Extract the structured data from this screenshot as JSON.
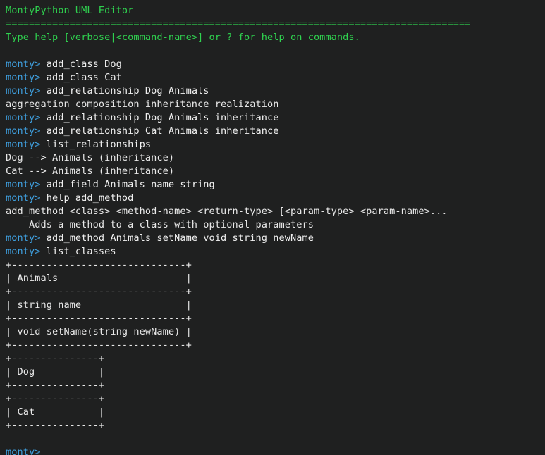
{
  "app": {
    "title": "MontyPython UML Editor",
    "separator": "================================================================================",
    "help_hint": "Type help [verbose|<command-name>] or ? for help on commands.",
    "prompt": "monty>",
    "colors": {
      "background": "#1f2020",
      "banner_green": "#2fd14f",
      "prompt_blue": "#3fa0e0",
      "output_white": "#e8e8e8"
    }
  },
  "session": {
    "lines": [
      {
        "kind": "banner",
        "text": "MontyPython UML Editor"
      },
      {
        "kind": "banner",
        "text": "================================================================================"
      },
      {
        "kind": "banner",
        "text": "Type help [verbose|<command-name>] or ? for help on commands."
      },
      {
        "kind": "blank",
        "text": ""
      },
      {
        "kind": "command",
        "prompt": "monty>",
        "text": " add_class Dog"
      },
      {
        "kind": "command",
        "prompt": "monty>",
        "text": " add_class Cat"
      },
      {
        "kind": "command",
        "prompt": "monty>",
        "text": " add_relationship Dog Animals"
      },
      {
        "kind": "output",
        "text": "aggregation composition inheritance realization"
      },
      {
        "kind": "command",
        "prompt": "monty>",
        "text": " add_relationship Dog Animals inheritance"
      },
      {
        "kind": "command",
        "prompt": "monty>",
        "text": " add_relationship Cat Animals inheritance"
      },
      {
        "kind": "command",
        "prompt": "monty>",
        "text": " list_relationships"
      },
      {
        "kind": "output",
        "text": "Dog --> Animals (inheritance)"
      },
      {
        "kind": "output",
        "text": "Cat --> Animals (inheritance)"
      },
      {
        "kind": "command",
        "prompt": "monty>",
        "text": " add_field Animals name string"
      },
      {
        "kind": "command",
        "prompt": "monty>",
        "text": " help add_method"
      },
      {
        "kind": "output",
        "text": "add_method <class> <method-name> <return-type> [<param-type> <param-name>..."
      },
      {
        "kind": "output",
        "text": "    Adds a method to a class with optional parameters"
      },
      {
        "kind": "command",
        "prompt": "monty>",
        "text": " add_method Animals setName void string newName"
      },
      {
        "kind": "command",
        "prompt": "monty>",
        "text": " list_classes"
      },
      {
        "kind": "output",
        "text": "+------------------------------+"
      },
      {
        "kind": "output",
        "text": "| Animals                      |"
      },
      {
        "kind": "output",
        "text": "+------------------------------+"
      },
      {
        "kind": "output",
        "text": "| string name                  |"
      },
      {
        "kind": "output",
        "text": "+------------------------------+"
      },
      {
        "kind": "output",
        "text": "| void setName(string newName) |"
      },
      {
        "kind": "output",
        "text": "+------------------------------+"
      },
      {
        "kind": "output",
        "text": "+---------------+"
      },
      {
        "kind": "output",
        "text": "| Dog           |"
      },
      {
        "kind": "output",
        "text": "+---------------+"
      },
      {
        "kind": "output",
        "text": "+---------------+"
      },
      {
        "kind": "output",
        "text": "| Cat           |"
      },
      {
        "kind": "output",
        "text": "+---------------+"
      },
      {
        "kind": "blank",
        "text": ""
      },
      {
        "kind": "command",
        "prompt": "monty>",
        "text": ""
      }
    ]
  }
}
